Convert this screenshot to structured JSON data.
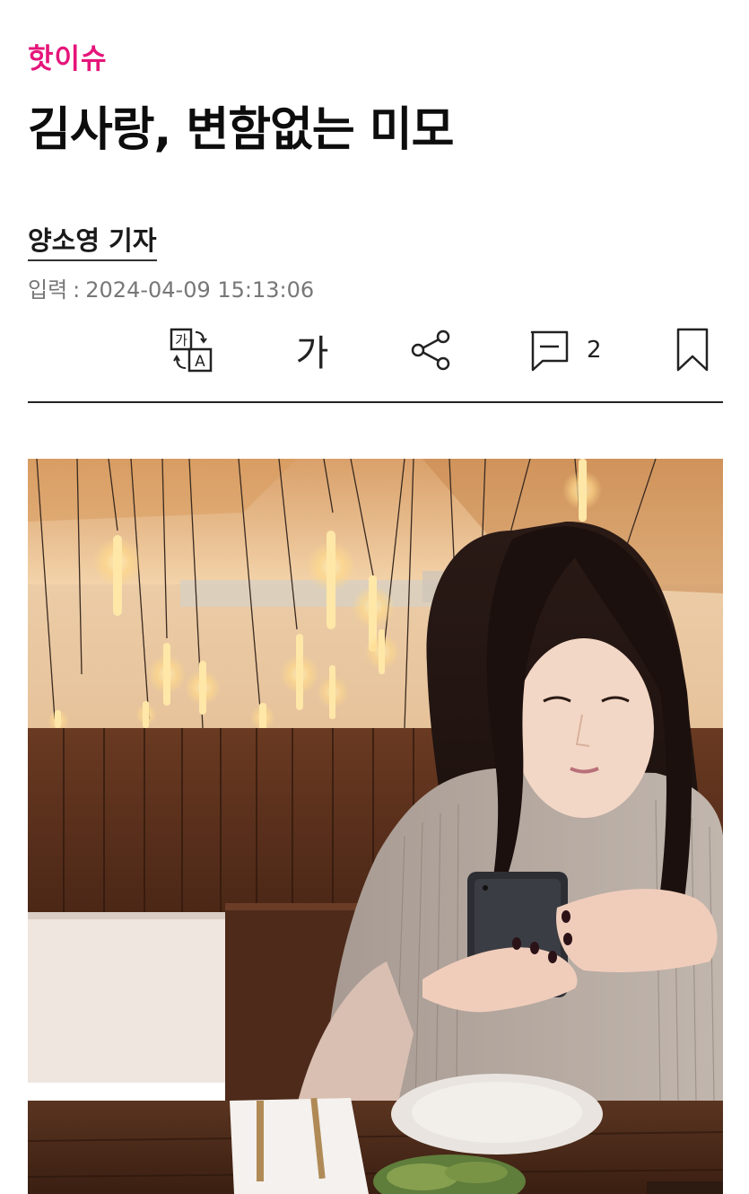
{
  "article": {
    "category": "핫이슈",
    "headline": "김사랑, 변함없는 미모",
    "byline": "양소영 기자",
    "timestamp_label": "입력",
    "timestamp_value": "2024-04-09 15:13:06"
  },
  "toolbar": {
    "font_size_glyph": "가",
    "translate_glyph_ko": "가",
    "translate_glyph_en": "A",
    "comment_count": "2"
  },
  "icons": {
    "translate": "translate-icon",
    "font_size": "font-size-icon",
    "share": "share-icon",
    "comment": "comment-icon",
    "bookmark": "bookmark-icon"
  },
  "colors": {
    "category": "#e5157a",
    "headline": "#0d0d0d",
    "divider": "#222222"
  }
}
